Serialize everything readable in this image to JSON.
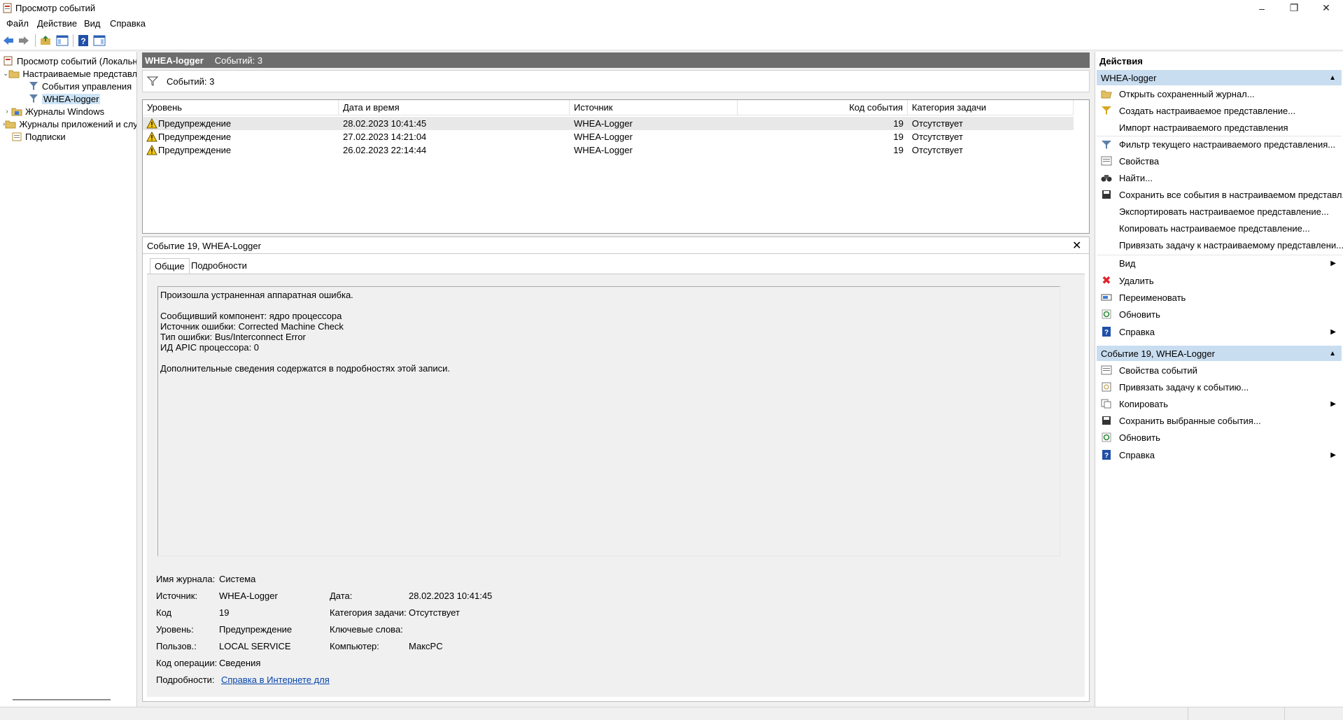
{
  "window": {
    "title": "Просмотр событий",
    "controls": [
      "minimize",
      "restore",
      "close"
    ]
  },
  "menu": [
    "Файл",
    "Действие",
    "Вид",
    "Справка"
  ],
  "toolbar": [
    "back-icon",
    "forward-icon",
    "up-folder-icon",
    "show-hide-tree-icon",
    "help-icon",
    "show-hide-action-pane-icon"
  ],
  "tree": {
    "root": "Просмотр событий (Локальный)",
    "items": [
      {
        "label": "Настраиваемые представления",
        "indent": 1
      },
      {
        "label": "События управления",
        "indent": 2
      },
      {
        "label": "WHEA-logger",
        "indent": 2
      },
      {
        "label": "Журналы Windows",
        "indent": 1
      },
      {
        "label": "Журналы приложений и служб",
        "indent": 1
      },
      {
        "label": "Подписки",
        "indent": 1
      }
    ]
  },
  "center": {
    "view_name": "WHEA-logger",
    "count_text": "Событий: 3",
    "filter_text": "Событий: 3",
    "columns": [
      "Уровень",
      "Дата и время",
      "Источник",
      "Код события",
      "Категория задачи"
    ],
    "rows": [
      {
        "level": "Предупреждение",
        "datetime": "28.02.2023 10:41:45",
        "source": "WHEA-Logger",
        "id": "19",
        "category": "Отсутствует"
      },
      {
        "level": "Предупреждение",
        "datetime": "27.02.2023 14:21:04",
        "source": "WHEA-Logger",
        "id": "19",
        "category": "Отсутствует"
      },
      {
        "level": "Предупреждение",
        "datetime": "26.02.2023 22:14:44",
        "source": "WHEA-Logger",
        "id": "19",
        "category": "Отсутствует"
      }
    ]
  },
  "detail": {
    "title": "Событие 19, WHEA-Logger",
    "tabs": [
      "Общие",
      "Подробности"
    ],
    "message": "Произошла устраненная аппаратная ошибка.\n\nСообщивший компонент: ядро процессора\nИсточник ошибки: Corrected Machine Check\nТип ошибки: Bus/Interconnect Error\nИД APIC процессора: 0\n\nДополнительные сведения содержатся в подробностях этой записи.",
    "props": {
      "log_name_label": "Имя журнала:",
      "log_name": "Система",
      "source_label": "Источник:",
      "source": "WHEA-Logger",
      "date_label": "Дата:",
      "date": "28.02.2023 10:41:45",
      "code_label": "Код",
      "code": "19",
      "category_label": "Категория задачи:",
      "category": "Отсутствует",
      "level_label": "Уровень:",
      "level": "Предупреждение",
      "keywords_label": "Ключевые слова:",
      "keywords": "",
      "user_label": "Пользов.:",
      "user": "LOCAL SERVICE",
      "computer_label": "Компьютер:",
      "computer": "МаксPC",
      "opcode_label": "Код операции:",
      "opcode": "Сведения",
      "details_label": "Подробности:",
      "details_link": "Справка в Интернете для "
    }
  },
  "actions": {
    "header": "Действия",
    "section1": "WHEA-logger",
    "items1": [
      {
        "label": "Открыть сохраненный журнал...",
        "icon": "open-log-icon"
      },
      {
        "label": "Создать настраиваемое представление...",
        "icon": "filter-create-icon"
      },
      {
        "label": "Импорт настраиваемого представления",
        "icon": ""
      },
      {
        "label": "Фильтр текущего настраиваемого представления...",
        "icon": "filter-icon"
      },
      {
        "label": "Свойства",
        "icon": "properties-icon"
      },
      {
        "label": "Найти...",
        "icon": "binoculars-icon"
      },
      {
        "label": "Сохранить все события в настраиваемом представл...",
        "icon": "save-icon"
      },
      {
        "label": "Экспортировать настраиваемое представление...",
        "icon": ""
      },
      {
        "label": "Копировать настраиваемое представление...",
        "icon": ""
      },
      {
        "label": "Привязать задачу к настраиваемому представлени...",
        "icon": ""
      },
      {
        "label": "Вид",
        "icon": "",
        "submenu": true
      },
      {
        "label": "Удалить",
        "icon": "delete-icon"
      },
      {
        "label": "Переименовать",
        "icon": "rename-icon"
      },
      {
        "label": "Обновить",
        "icon": "refresh-icon"
      },
      {
        "label": "Справка",
        "icon": "help-icon",
        "submenu": true
      }
    ],
    "section2": "Событие 19, WHEA-Logger",
    "items2": [
      {
        "label": "Свойства событий",
        "icon": "event-properties-icon"
      },
      {
        "label": "Привязать задачу к событию...",
        "icon": "attach-task-icon"
      },
      {
        "label": "Копировать",
        "icon": "copy-icon",
        "submenu": true
      },
      {
        "label": "Сохранить выбранные события...",
        "icon": "save-icon"
      },
      {
        "label": "Обновить",
        "icon": "refresh-icon"
      },
      {
        "label": "Справка",
        "icon": "help-icon",
        "submenu": true
      }
    ]
  },
  "colors": {
    "header_bar": "#6d6d6d",
    "selection": "#cce4f7",
    "section_bar": "#c9ddf0",
    "warning": "#f2c811",
    "delete_red": "#e0242d",
    "help_blue": "#1f4fa8"
  }
}
